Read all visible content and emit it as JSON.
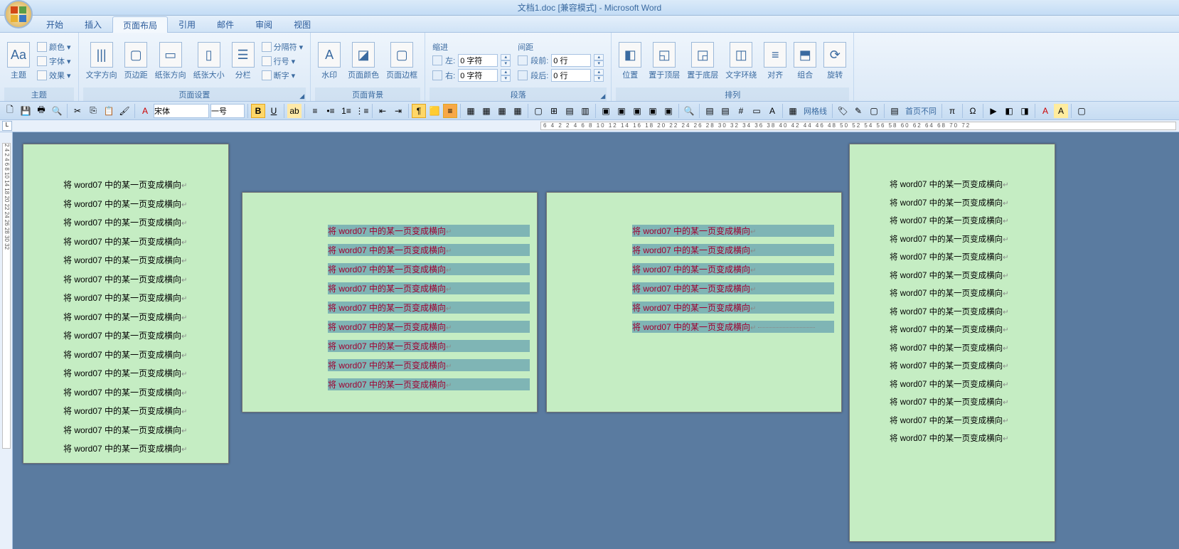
{
  "title": "文档1.doc [兼容模式] - Microsoft Word",
  "tabs": [
    "开始",
    "插入",
    "页面布局",
    "引用",
    "邮件",
    "审阅",
    "视图"
  ],
  "active_tab": 2,
  "ribbon": {
    "theme": {
      "label": "主题",
      "btns": [
        "主题"
      ],
      "side": [
        "颜色 ▾",
        "字体 ▾",
        "效果 ▾"
      ]
    },
    "pagesetup": {
      "label": "页面设置",
      "btns": [
        "文字方向",
        "页边距",
        "纸张方向",
        "纸张大小",
        "分栏"
      ],
      "side": [
        "分隔符 ▾",
        "行号 ▾",
        "断字 ▾"
      ]
    },
    "bg": {
      "label": "页面背景",
      "btns": [
        "水印",
        "页面颜色",
        "页面边框"
      ]
    },
    "para": {
      "label": "段落",
      "indent": {
        "head": "缩进",
        "left": "左:",
        "right": "右:",
        "lval": "0 字符",
        "rval": "0 字符"
      },
      "spacing": {
        "head": "间距",
        "before": "段前:",
        "after": "段后:",
        "bval": "0 行",
        "aval": "0 行"
      }
    },
    "arrange": {
      "label": "排列",
      "btns": [
        "位置",
        "置于顶层",
        "置于底层",
        "文字环绕",
        "对齐",
        "组合",
        "旋转"
      ]
    }
  },
  "qat": {
    "font": "宋体",
    "size": "一号",
    "gridlines": "网格线",
    "firstdiff": "首页不同"
  },
  "ruler_ticks": "6 4 2   2 4 6 8 10 12 14 16 18 20 22 24 26 28 30 32 34 36 38 40 42 44 46 48 50 52 54 56 58 60 62 64    68 70 72",
  "vruler": "2   4   2 4 6 8 10 14 18 20 22 24 26 28 30 32",
  "doc_line": "将 word07 中的某一页变成横向",
  "p1_count": 15,
  "p2_count": 9,
  "p3_count": 6,
  "p4_count": 15
}
